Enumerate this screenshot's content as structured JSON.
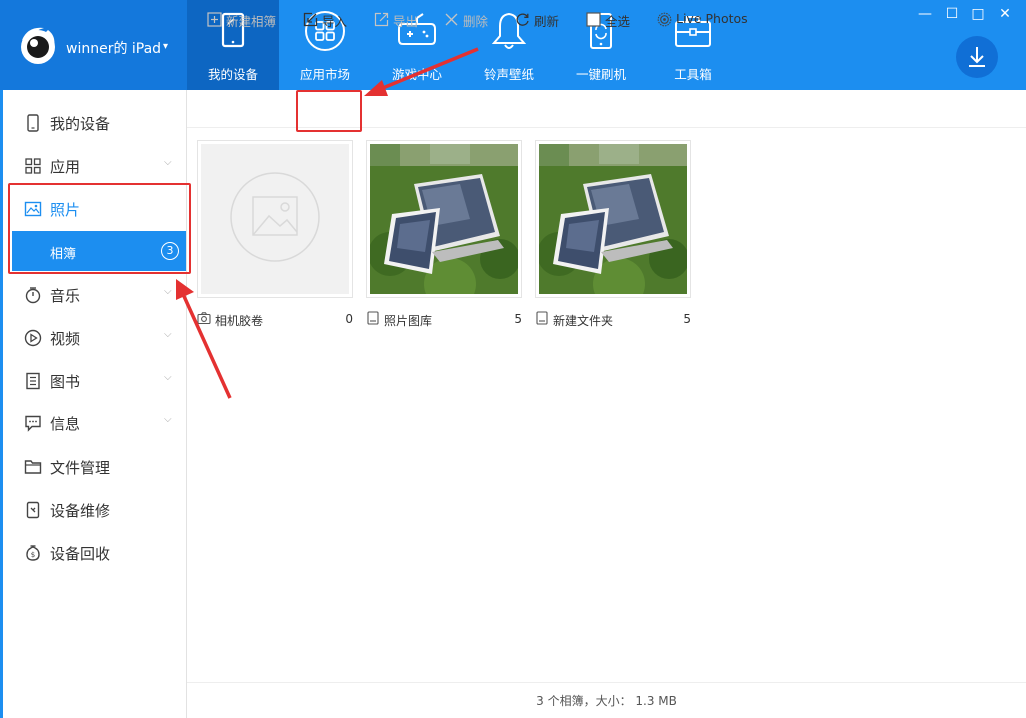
{
  "app": {
    "device_name": "winner的 iPad",
    "caret": "▾"
  },
  "nav": [
    {
      "label": "我的设备",
      "icon": "tablet-icon",
      "active": true
    },
    {
      "label": "应用市场",
      "icon": "apps-grid-icon"
    },
    {
      "label": "游戏中心",
      "icon": "gamepad-icon"
    },
    {
      "label": "铃声壁纸",
      "icon": "bell-icon"
    },
    {
      "label": "一键刷机",
      "icon": "refresh-device-icon"
    },
    {
      "label": "工具箱",
      "icon": "toolbox-icon"
    }
  ],
  "window": {
    "minimize": "—",
    "restore": "☐",
    "maximize": "□",
    "close": "✕",
    "download_icon": "download-icon"
  },
  "sidebar": {
    "items": [
      {
        "label": "我的设备",
        "icon": "device-icon"
      },
      {
        "label": "应用",
        "icon": "apps-icon",
        "chevron": "⌵"
      },
      {
        "label": "照片",
        "icon": "photo-icon"
      },
      {
        "label": "音乐",
        "icon": "music-icon",
        "chevron": "⌵"
      },
      {
        "label": "视频",
        "icon": "video-icon",
        "chevron": "⌵"
      },
      {
        "label": "图书",
        "icon": "book-icon",
        "chevron": "⌵"
      },
      {
        "label": "信息",
        "icon": "message-icon",
        "chevron": "⌵"
      },
      {
        "label": "文件管理",
        "icon": "folder-icon"
      },
      {
        "label": "设备维修",
        "icon": "repair-icon"
      },
      {
        "label": "设备回收",
        "icon": "recycle-icon"
      }
    ],
    "sub": {
      "label": "相簿",
      "count": "3"
    }
  },
  "toolbar": {
    "new_album": "新建相簿",
    "import": "导入",
    "export": "导出",
    "delete": "删除",
    "refresh": "刷新",
    "select_all": "全选",
    "live_photos": "Live Photos"
  },
  "albums": [
    {
      "name": "相机胶卷",
      "count": "0",
      "icon": "camera-icon"
    },
    {
      "name": "照片图库",
      "count": "5",
      "icon": "album-icon"
    },
    {
      "name": "新建文件夹",
      "count": "5",
      "icon": "album-icon"
    }
  ],
  "status": "3 个相簿，大小： 1.3 MB",
  "colors": {
    "accent": "#1c8ef0",
    "header": "#1c8ef0",
    "active_nav": "#0d66c2",
    "annotation": "#e43131"
  }
}
